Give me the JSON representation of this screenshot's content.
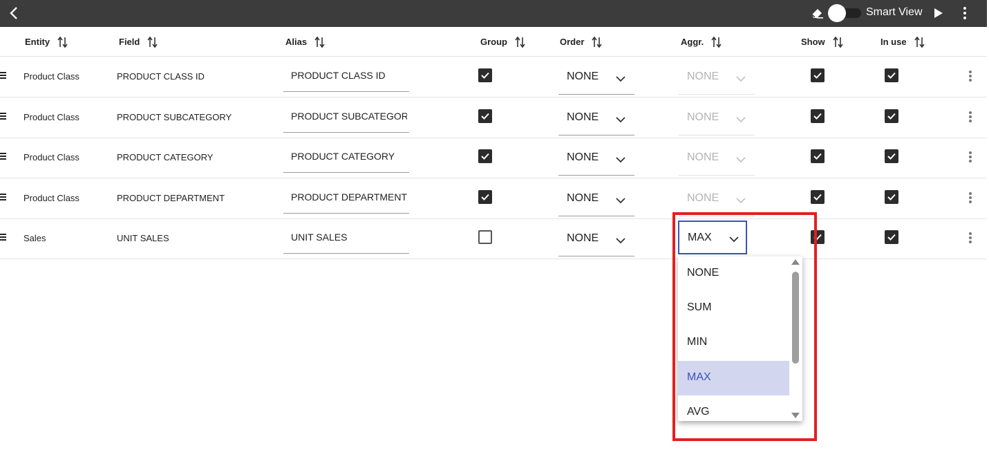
{
  "topbar": {
    "smart_view_label": "Smart View",
    "smart_view_enabled": false
  },
  "columns": {
    "entity": "Entity",
    "field": "Field",
    "alias": "Alias",
    "group": "Group",
    "order": "Order",
    "aggr": "Aggr.",
    "show": "Show",
    "in_use": "In use"
  },
  "rows": [
    {
      "entity": "Product Class",
      "field": "PRODUCT CLASS ID",
      "alias": "PRODUCT CLASS ID",
      "group": true,
      "order": "NONE",
      "aggr": "NONE",
      "show": true,
      "in_use": true
    },
    {
      "entity": "Product Class",
      "field": "PRODUCT SUBCATEGORY",
      "alias": "PRODUCT SUBCATEGOR",
      "group": true,
      "order": "NONE",
      "aggr": "NONE",
      "show": true,
      "in_use": true
    },
    {
      "entity": "Product Class",
      "field": "PRODUCT CATEGORY",
      "alias": "PRODUCT CATEGORY",
      "group": true,
      "order": "NONE",
      "aggr": "NONE",
      "show": true,
      "in_use": true
    },
    {
      "entity": "Product Class",
      "field": "PRODUCT DEPARTMENT",
      "alias": "PRODUCT DEPARTMENT",
      "group": true,
      "order": "NONE",
      "aggr": "NONE",
      "show": true,
      "in_use": true
    },
    {
      "entity": "Sales",
      "field": "UNIT SALES",
      "alias": "UNIT SALES",
      "group": false,
      "order": "NONE",
      "aggr": "MAX",
      "show": true,
      "in_use": true
    }
  ],
  "aggr_dropdown": {
    "selected": "MAX",
    "options": [
      "NONE",
      "SUM",
      "MIN",
      "MAX",
      "AVG"
    ]
  },
  "colors": {
    "topbar": "#3c3c3c",
    "accent": "#3f51b5",
    "selected_option_bg": "#d2d6ef",
    "highlight": "#e02020"
  }
}
